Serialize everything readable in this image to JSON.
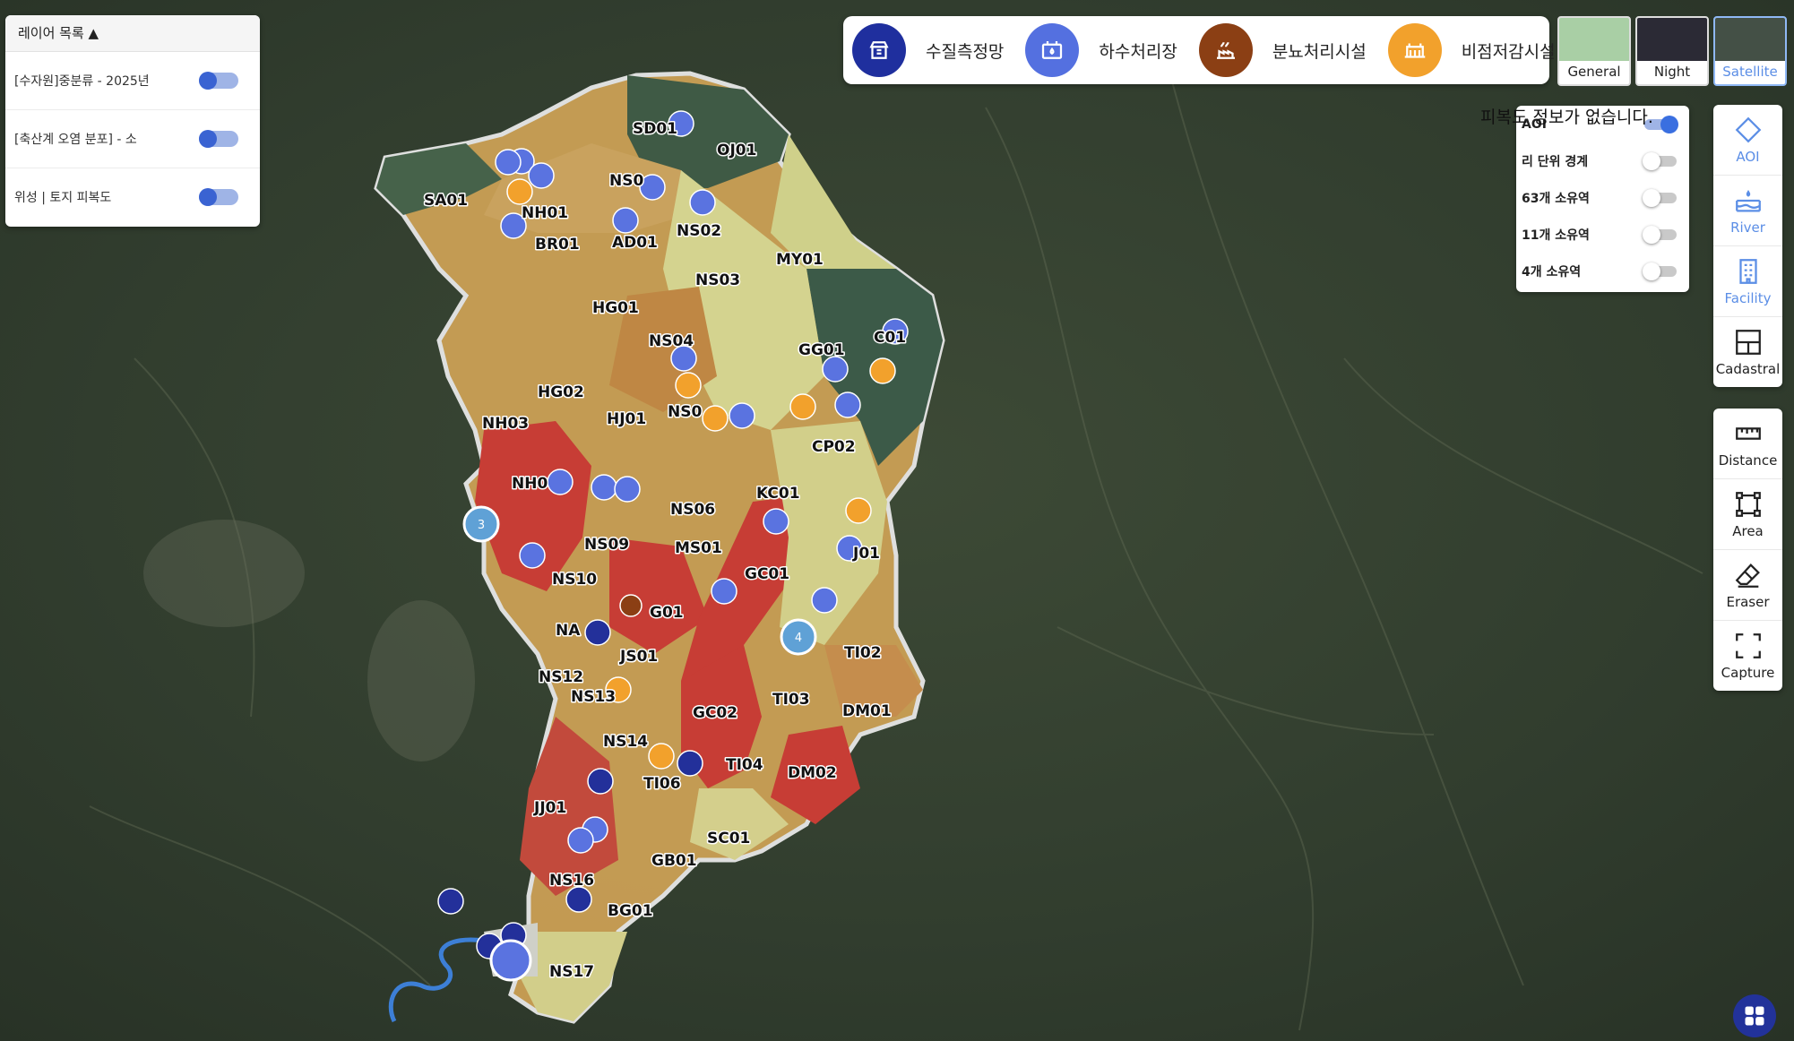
{
  "layer_panel": {
    "title": "레이어 목록 ▲",
    "items": [
      {
        "label": "[수자원]중분류 - 2025년",
        "on": true
      },
      {
        "label": "[축산계 오염 분포] - 소",
        "on": true
      },
      {
        "label": "위성 | 토지 피복도",
        "on": true
      }
    ]
  },
  "legend": {
    "items": [
      {
        "label": "수질측정망",
        "color": "#1f2f9e",
        "icon": "station-icon"
      },
      {
        "label": "하수처리장",
        "color": "#5470e0",
        "icon": "sewage-icon"
      },
      {
        "label": "분뇨처리시설",
        "color": "#8b3f14",
        "icon": "manure-icon"
      },
      {
        "label": "비점저감시설",
        "color": "#f2a12c",
        "icon": "nonpoint-icon"
      }
    ]
  },
  "basemaps": [
    {
      "label": "General",
      "active": false
    },
    {
      "label": "Night",
      "active": false
    },
    {
      "label": "Satellite",
      "active": true
    }
  ],
  "info_text": "피복도 정보가 없습니다.",
  "boundary_panel": {
    "items": [
      {
        "label": "AOI",
        "on": true
      },
      {
        "label": "리 단위 경계",
        "on": false
      },
      {
        "label": "63개 소유역",
        "on": false
      },
      {
        "label": "11개 소유역",
        "on": false
      },
      {
        "label": "4개 소유역",
        "on": false
      }
    ]
  },
  "tools_top": [
    {
      "label": "AOI",
      "icon": "aoi-icon"
    },
    {
      "label": "River",
      "icon": "river-icon"
    },
    {
      "label": "Facility",
      "icon": "facility-icon"
    },
    {
      "label": "Cadastral",
      "icon": "cadastral-icon"
    }
  ],
  "tools_bottom": [
    {
      "label": "Distance",
      "icon": "ruler-icon"
    },
    {
      "label": "Area",
      "icon": "area-icon"
    },
    {
      "label": "Eraser",
      "icon": "eraser-icon"
    },
    {
      "label": "Capture",
      "icon": "capture-icon"
    }
  ],
  "region_labels": [
    "SD01",
    "OJ01",
    "SA01",
    "NH01",
    "NS0",
    "BR01",
    "AD01",
    "NS02",
    "MY01",
    "NS03",
    "HG01",
    "NS04",
    "GG01",
    "C01",
    "HG02",
    "HJ01",
    "NS0",
    "CP02",
    "NH03",
    "NH0",
    "NS06",
    "KC01",
    "NS09",
    "MS01",
    "NS10",
    "GC01",
    "J01",
    "G01",
    "NA",
    "JS01",
    "TI02",
    "NS12",
    "NS13",
    "TI03",
    "DM01",
    "NS14",
    "GC02",
    "TI04",
    "DM02",
    "TI06",
    "JJ01",
    "SC01",
    "GB01",
    "NS16",
    "BG01",
    "NS17"
  ],
  "clusters": [
    "3",
    "4"
  ]
}
